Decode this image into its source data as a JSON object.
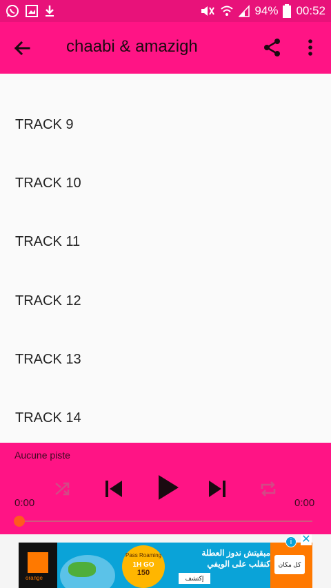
{
  "status_bar": {
    "battery": "94%",
    "time": "00:52",
    "icons": [
      "whatsapp-icon",
      "gallery-icon",
      "download-icon",
      "mute-icon",
      "wifi-icon",
      "signal-icon",
      "battery-icon"
    ]
  },
  "app_bar": {
    "title": "chaabi & amazigh",
    "icons": [
      "back-arrow-icon",
      "share-icon",
      "more-vert-icon"
    ]
  },
  "tracks": [
    {
      "label": "TRACK 9"
    },
    {
      "label": "TRACK 10"
    },
    {
      "label": "TRACK 11"
    },
    {
      "label": "TRACK 12"
    },
    {
      "label": "TRACK 13"
    },
    {
      "label": "TRACK 14"
    }
  ],
  "player": {
    "status": "Aucune piste",
    "time_start": "0:00",
    "time_end": "0:00",
    "progress": 0,
    "icons": [
      "shuffle-icon",
      "skip-previous-icon",
      "play-icon",
      "skip-next-icon",
      "repeat-icon"
    ]
  },
  "ad": {
    "brand": "orange",
    "badge_line1": "Pass Roaming",
    "badge_line2": "1H GO",
    "badge_line3": "150",
    "text_line1": "مبقيتش ندوز العطلة",
    "text_line2": "كنقلب على الويفي",
    "cta": "إكتشف",
    "side_tag": "كل مكان",
    "info_symbol": "i",
    "close_symbol": "✕"
  },
  "colors": {
    "status_bar": "#e8127a",
    "app_bar": "#ff1485",
    "player": "#ff1485",
    "seek_thumb": "#ff5a1f",
    "list_bg": "#fafafa"
  }
}
